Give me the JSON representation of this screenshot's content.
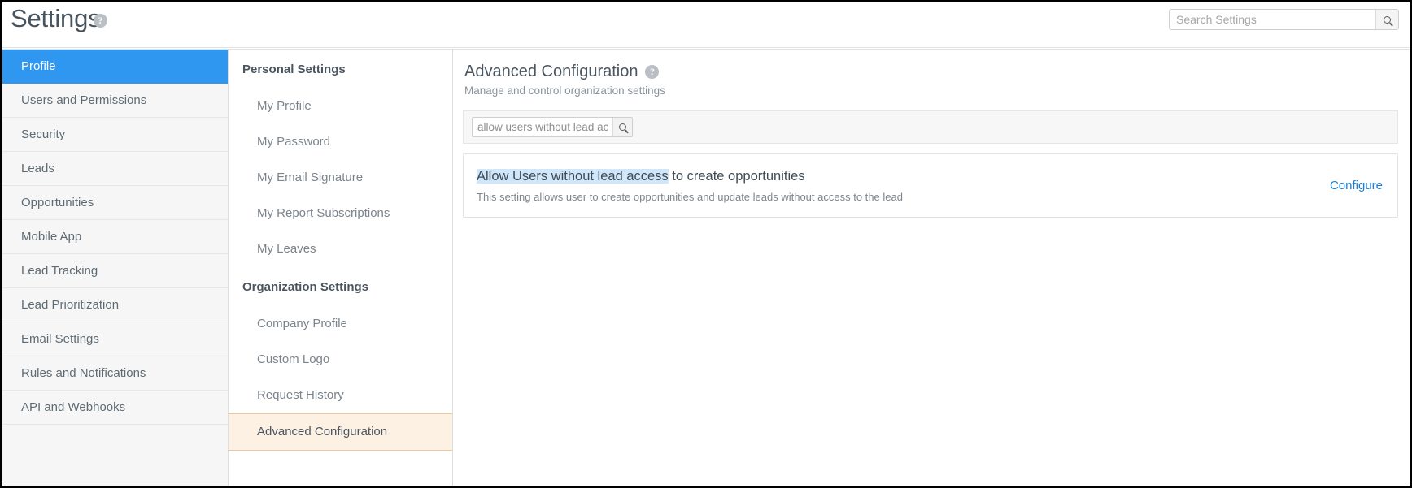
{
  "header": {
    "title": "Settings",
    "help_icon": "help-circle-icon",
    "search": {
      "placeholder": "Search Settings",
      "value": "",
      "button_icon": "search-icon"
    }
  },
  "sidebar": {
    "items": [
      {
        "label": "Profile",
        "active": true
      },
      {
        "label": "Users and Permissions",
        "active": false
      },
      {
        "label": "Security",
        "active": false
      },
      {
        "label": "Leads",
        "active": false
      },
      {
        "label": "Opportunities",
        "active": false
      },
      {
        "label": "Mobile App",
        "active": false
      },
      {
        "label": "Lead Tracking",
        "active": false
      },
      {
        "label": "Lead Prioritization",
        "active": false
      },
      {
        "label": "Email Settings",
        "active": false
      },
      {
        "label": "Rules and Notifications",
        "active": false
      },
      {
        "label": "API and Webhooks",
        "active": false
      }
    ]
  },
  "subnav": {
    "groups": [
      {
        "title": "Personal Settings",
        "items": [
          {
            "label": "My Profile",
            "active": false
          },
          {
            "label": "My Password",
            "active": false
          },
          {
            "label": "My Email Signature",
            "active": false
          },
          {
            "label": "My Report Subscriptions",
            "active": false
          },
          {
            "label": "My Leaves",
            "active": false
          }
        ]
      },
      {
        "title": "Organization Settings",
        "items": [
          {
            "label": "Company Profile",
            "active": false
          },
          {
            "label": "Custom Logo",
            "active": false
          },
          {
            "label": "Request History",
            "active": false
          },
          {
            "label": "Advanced Configuration",
            "active": true
          }
        ]
      }
    ]
  },
  "content": {
    "title": "Advanced Configuration",
    "help_icon": "help-circle-icon",
    "subtitle": "Manage and control organization settings",
    "filter": {
      "value": "allow users without lead access",
      "placeholder": "",
      "button_icon": "search-icon"
    },
    "results": [
      {
        "title_highlight": "Allow Users without lead access",
        "title_rest": " to create opportunities",
        "description": "This setting allows user to create opportunities and update leads without access to the lead",
        "action_label": "Configure"
      }
    ]
  },
  "colors": {
    "accent_blue": "#2f97f0",
    "link_blue": "#1a7fd4",
    "highlight_bg": "#cfe6fb",
    "active_sub_bg": "#fdf1e3",
    "active_sub_border": "#f0c89a"
  }
}
